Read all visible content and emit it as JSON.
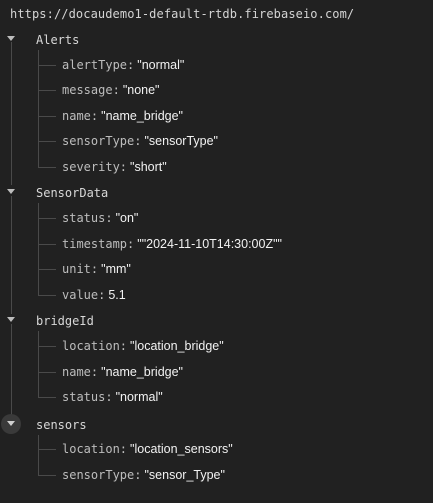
{
  "database": {
    "root_url": "https://docaudemo1-default-rtdb.firebaseio.com/"
  },
  "tree": {
    "alerts": {
      "key": "Alerts",
      "toggle_icon": "caret-down-icon",
      "children": [
        {
          "key": "alertType",
          "value": "\"normal\""
        },
        {
          "key": "message",
          "value": "\"none\""
        },
        {
          "key": "name",
          "value": "\"name_bridge\""
        },
        {
          "key": "sensorType",
          "value": "\"sensorType\""
        },
        {
          "key": "severity",
          "value": "\"short\""
        }
      ]
    },
    "sensor_data": {
      "key": "SensorData",
      "toggle_icon": "caret-down-icon",
      "children": [
        {
          "key": "status",
          "value": "\"on\""
        },
        {
          "key": "timestamp",
          "value": "\"\"2024-11-10T14:30:00Z\"\""
        },
        {
          "key": "unit",
          "value": "\"mm\""
        },
        {
          "key": "value",
          "value": "5.1"
        }
      ]
    },
    "bridge_id": {
      "key": "bridgeId",
      "toggle_icon": "caret-down-icon",
      "children": [
        {
          "key": "location",
          "value": "\"location_bridge\""
        },
        {
          "key": "name",
          "value": "\"name_bridge\""
        },
        {
          "key": "status",
          "value": "\"normal\""
        }
      ]
    },
    "sensors": {
      "key": "sensors",
      "toggle_icon": "caret-down-icon",
      "children": [
        {
          "key": "location",
          "value": "\"location_sensors\""
        },
        {
          "key": "sensorType",
          "value": "\"sensor_Type\""
        }
      ]
    }
  },
  "colors": {
    "background": "#212121",
    "guide_line": "#4a4a4a",
    "key_text": "#bdbdbd",
    "value_text": "#f2f2f2",
    "hover_circle": "#3a3a3a"
  }
}
